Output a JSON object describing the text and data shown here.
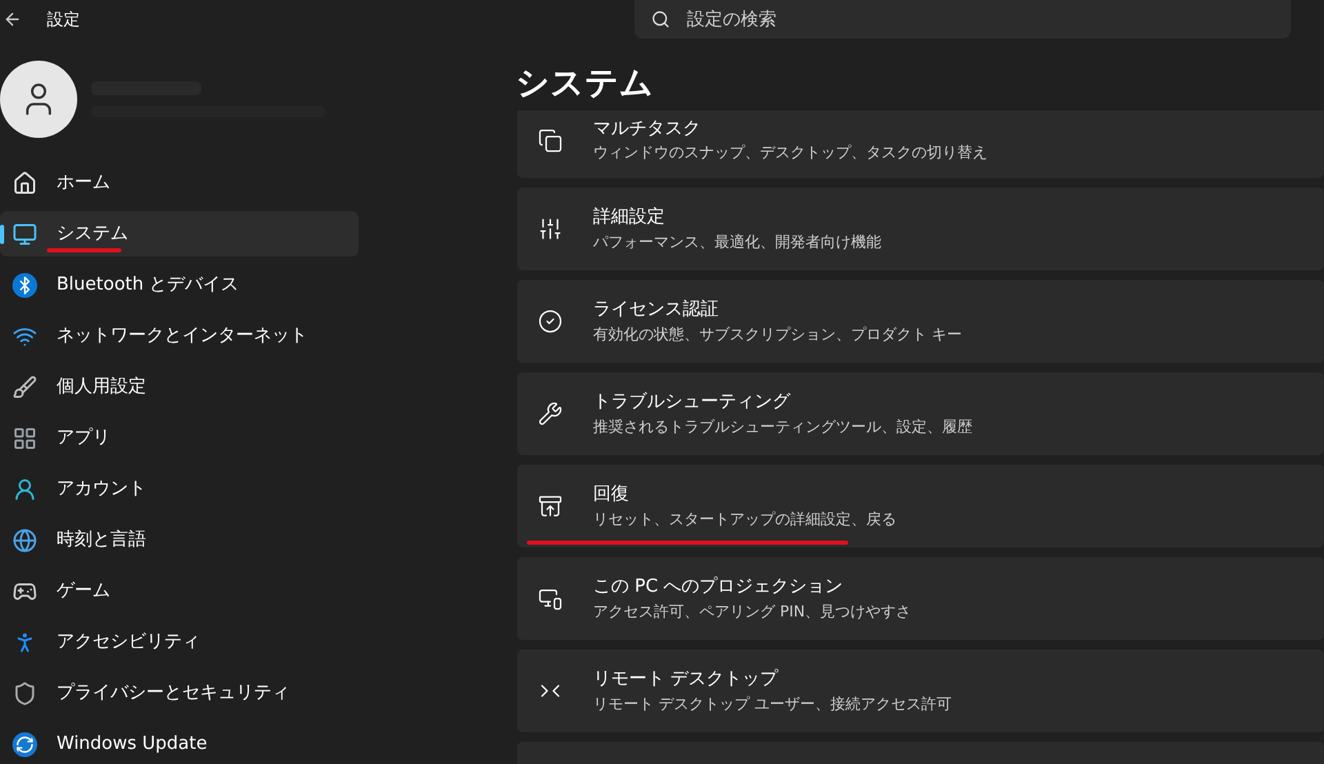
{
  "window": {
    "title": "設定"
  },
  "search": {
    "placeholder": "設定の検索"
  },
  "sidebar": {
    "items": [
      {
        "label": "ホーム",
        "selected": false,
        "underlined": false
      },
      {
        "label": "システム",
        "selected": true,
        "underlined": true
      },
      {
        "label": "Bluetooth とデバイス",
        "selected": false,
        "underlined": false
      },
      {
        "label": "ネットワークとインターネット",
        "selected": false,
        "underlined": false
      },
      {
        "label": "個人用設定",
        "selected": false,
        "underlined": false
      },
      {
        "label": "アプリ",
        "selected": false,
        "underlined": false
      },
      {
        "label": "アカウント",
        "selected": false,
        "underlined": false
      },
      {
        "label": "時刻と言語",
        "selected": false,
        "underlined": false
      },
      {
        "label": "ゲーム",
        "selected": false,
        "underlined": false
      },
      {
        "label": "アクセシビリティ",
        "selected": false,
        "underlined": false
      },
      {
        "label": "プライバシーとセキュリティ",
        "selected": false,
        "underlined": false
      },
      {
        "label": "Windows Update",
        "selected": false,
        "underlined": false
      }
    ]
  },
  "page": {
    "title": "システム",
    "cards": [
      {
        "title": "マルチタスク",
        "subtitle": "ウィンドウのスナップ、デスクトップ、タスクの切り替え",
        "underlined": false
      },
      {
        "title": "詳細設定",
        "subtitle": "パフォーマンス、最適化、開発者向け機能",
        "underlined": false
      },
      {
        "title": "ライセンス認証",
        "subtitle": "有効化の状態、サブスクリプション、プロダクト キー",
        "underlined": false
      },
      {
        "title": "トラブルシューティング",
        "subtitle": "推奨されるトラブルシューティングツール、設定、履歴",
        "underlined": false
      },
      {
        "title": "回復",
        "subtitle": "リセット、スタートアップの詳細設定、戻る",
        "underlined": true
      },
      {
        "title": "この PC へのプロジェクション",
        "subtitle": "アクセス許可、ペアリング PIN、見つけやすさ",
        "underlined": false
      },
      {
        "title": "リモート デスクトップ",
        "subtitle": "リモート デスクトップ ユーザー、接続アクセス許可",
        "underlined": false
      }
    ]
  }
}
